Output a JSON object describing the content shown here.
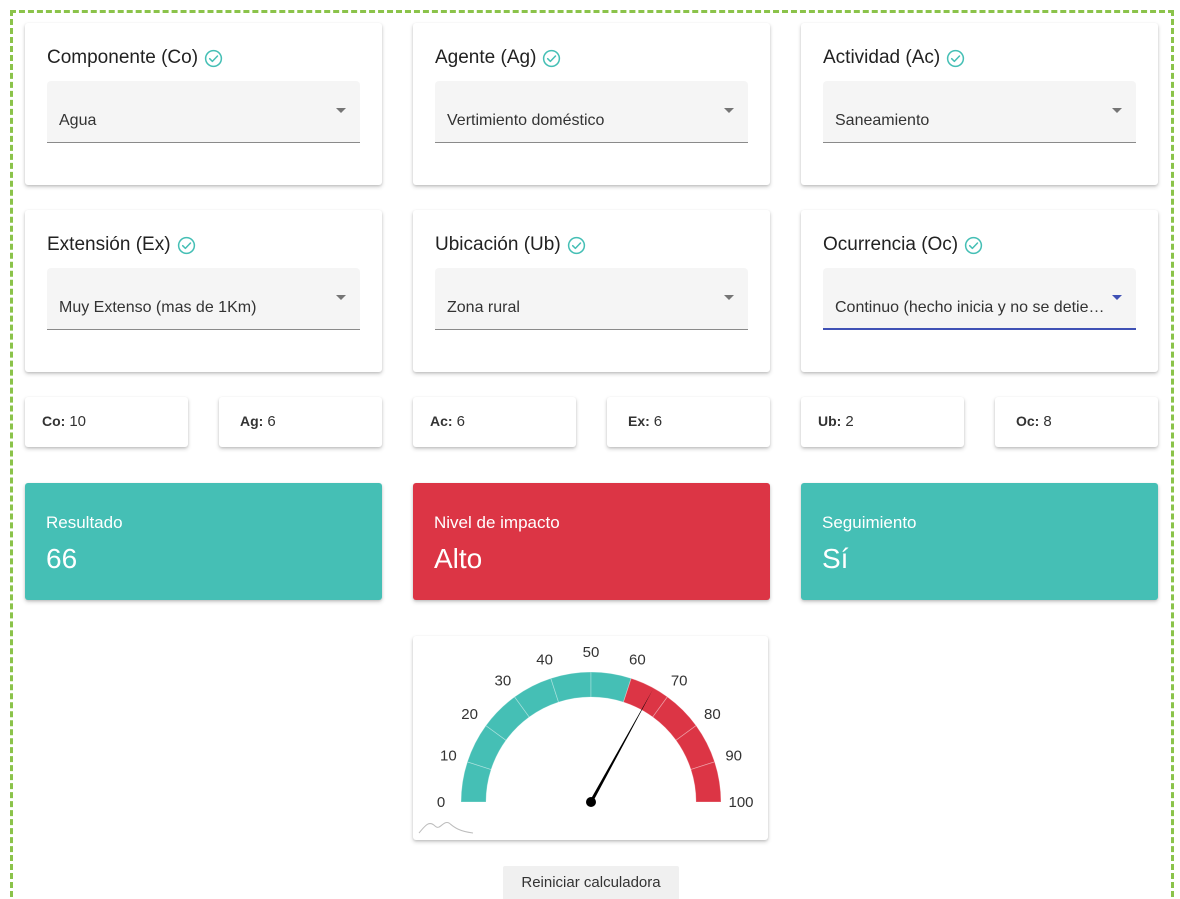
{
  "selectors": [
    {
      "id": "co",
      "title": "Componente (Co)",
      "value": "Agua"
    },
    {
      "id": "ag",
      "title": "Agente (Ag)",
      "value": "Vertimiento doméstico"
    },
    {
      "id": "ac",
      "title": "Actividad (Ac)",
      "value": "Saneamiento"
    },
    {
      "id": "ex",
      "title": "Extensión (Ex)",
      "value": "Muy Extenso (mas de 1Km)"
    },
    {
      "id": "ub",
      "title": "Ubicación (Ub)",
      "value": "Zona rural"
    },
    {
      "id": "oc",
      "title": "Ocurrencia (Oc)",
      "value": "Continuo (hecho inicia y no se detie…",
      "focused": true
    }
  ],
  "scores": [
    {
      "label": "Co:",
      "value": "10"
    },
    {
      "label": "Ag:",
      "value": "6"
    },
    {
      "label": "Ac:",
      "value": "6"
    },
    {
      "label": "Ex:",
      "value": "6"
    },
    {
      "label": "Ub:",
      "value": "2"
    },
    {
      "label": "Oc:",
      "value": "8"
    }
  ],
  "results": [
    {
      "label": "Resultado",
      "value": "66",
      "color": "#45bfb5"
    },
    {
      "label": "Nivel de impacto",
      "value": "Alto",
      "color": "#dc3545"
    },
    {
      "label": "Seguimiento",
      "value": "Sí",
      "color": "#45bfb5"
    }
  ],
  "gauge": {
    "value": 66,
    "min": 0,
    "max": 100,
    "ticks": [
      "0",
      "10",
      "20",
      "30",
      "40",
      "50",
      "60",
      "70",
      "80",
      "90",
      "100"
    ],
    "bands": [
      {
        "from": 0,
        "to": 60,
        "color": "#45bfb5"
      },
      {
        "from": 60,
        "to": 100,
        "color": "#dc3545"
      }
    ],
    "needle_color": "#000000"
  },
  "colors": {
    "check": "#45bfb5",
    "focus": "#3f51b5",
    "frame": "#8bc34a"
  },
  "actions": {
    "reset_label": "Reiniciar calculadora"
  }
}
